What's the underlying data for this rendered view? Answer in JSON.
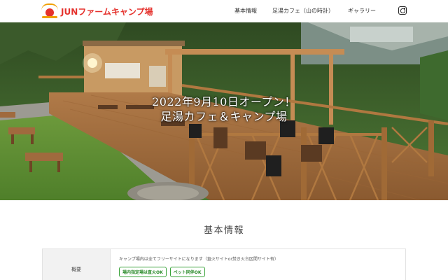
{
  "header": {
    "logo_text": "JUNファームキャンプ場",
    "nav": [
      "基本情報",
      "足湯カフェ（山の時計）",
      "ギャラリー"
    ],
    "instagram_icon": "instagram-icon"
  },
  "hero": {
    "caption_line1": "2022年9月10日オープン！",
    "caption_line2": "足湯カフェ＆キャンプ場",
    "slides_total": 3,
    "active_slide": 1
  },
  "section": {
    "title": "基本情報"
  },
  "info": {
    "label": "概要",
    "text": "キャンプ場内は全てフリーサイトになります（直火サイトor焚き火台区間サイト有）",
    "tags": [
      "場内指定場は直火OK",
      "ペット同伴OK"
    ]
  },
  "colors": {
    "brand_red": "#e5322d",
    "brand_orange": "#f0a000",
    "tag_green": "#2a8a2a"
  }
}
